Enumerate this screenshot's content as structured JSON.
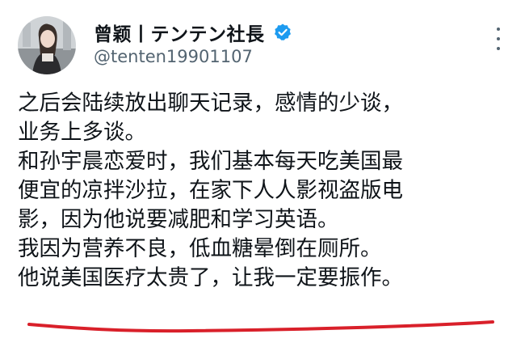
{
  "post": {
    "author": {
      "display_name": "曾颖丨テンテン社長",
      "handle": "@tenten19901107",
      "verified_icon": "verified-badge-icon",
      "verified_color": "#1d9bf0"
    },
    "more_icon": "more-options-icon",
    "lines": [
      "之后会陆续放出聊天记录，感情的少谈，",
      "业务上多谈。",
      "和孙宇晨恋爱时，我们基本每天吃美国最",
      "便宜的凉拌沙拉，在家下人人影视盗版电",
      "影，因为他说要减肥和学习英语。",
      "我因为营养不良，低血糖晕倒在厕所。",
      "他说美国医疗太贵了，让我一定要振作。"
    ],
    "annotation": {
      "type": "hand-drawn-underline",
      "color": "#d9202a"
    }
  }
}
